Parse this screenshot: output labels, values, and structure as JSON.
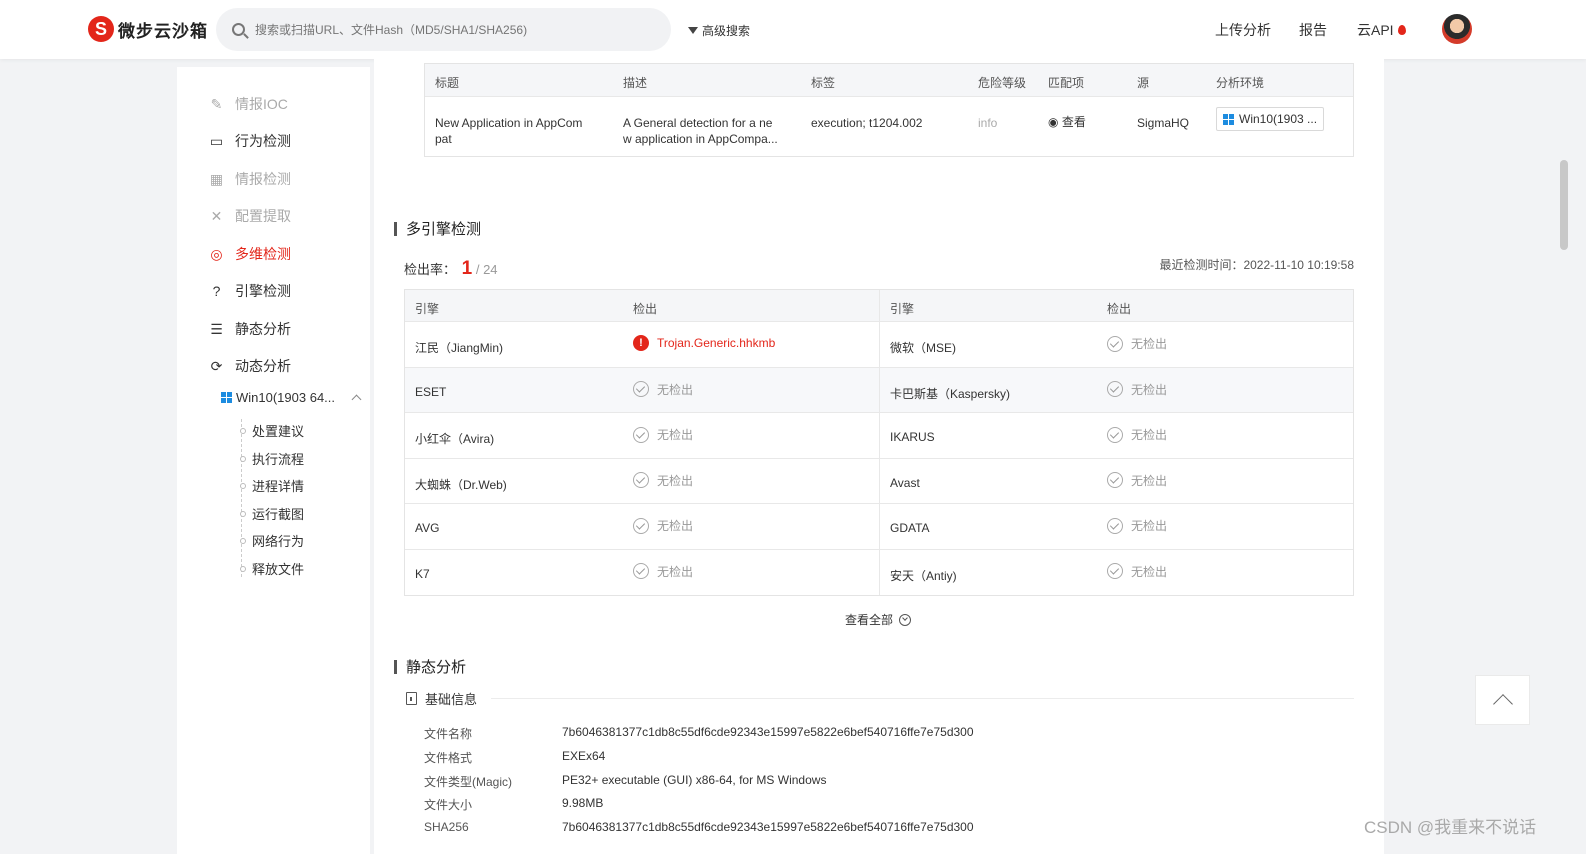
{
  "header": {
    "logo_letter": "S",
    "logo_text": "微步云沙箱",
    "search_placeholder": "搜索或扫描URL、文件Hash（MD5/SHA1/SHA256)",
    "advanced_search": "高级搜索",
    "nav": [
      "上传分析",
      "报告",
      "云API"
    ]
  },
  "sidebar": {
    "items": [
      {
        "label": "情报IOC",
        "icon": "✎",
        "state": "disabled"
      },
      {
        "label": "行为检测",
        "icon": "▭",
        "state": "normal"
      },
      {
        "label": "情报检测",
        "icon": "▦",
        "state": "disabled"
      },
      {
        "label": "配置提取",
        "icon": "✕",
        "state": "disabled"
      },
      {
        "label": "多维检测",
        "icon": "◎",
        "state": "active"
      },
      {
        "label": "引擎检测",
        "icon": "?",
        "state": "normal"
      },
      {
        "label": "静态分析",
        "icon": "☰",
        "state": "normal"
      },
      {
        "label": "动态分析",
        "icon": "⟳",
        "state": "normal"
      }
    ],
    "env_label": "Win10(1903 64...",
    "sub_items": [
      "处置建议",
      "执行流程",
      "进程详情",
      "运行截图",
      "网络行为",
      "释放文件"
    ]
  },
  "sigma": {
    "headers": [
      "标题",
      "描述",
      "标签",
      "危险等级",
      "匹配项",
      "源",
      "分析环境"
    ],
    "row": {
      "title": "New Application in AppCompat",
      "title_line1": "New Application in AppCom",
      "title_line2": "pat",
      "desc_line1": "A General detection for a ne",
      "desc_line2": "w application in AppCompa...",
      "tags": "execution; t1204.002",
      "level": "info",
      "match": "查看",
      "source": "SigmaHQ",
      "env": "Win10(1903 ..."
    }
  },
  "multi_engine": {
    "title": "多引擎检测",
    "rate_label": "检出率：",
    "detected": "1",
    "total": "/ 24",
    "last_time": "最近检测时间：2022-11-10 10:19:58",
    "headers": [
      "引擎",
      "检出",
      "引擎",
      "检出"
    ],
    "rows": [
      {
        "left": "江民（JiangMin)",
        "left_result": "Trojan.Generic.hhkmb",
        "left_detected": true,
        "right": "微软（MSE)",
        "right_result": "无检出"
      },
      {
        "left": "ESET",
        "left_result": "无检出",
        "left_detected": false,
        "right": "卡巴斯基（Kaspersky)",
        "right_result": "无检出"
      },
      {
        "left": "小红伞（Avira)",
        "left_result": "无检出",
        "left_detected": false,
        "right": "IKARUS",
        "right_result": "无检出"
      },
      {
        "left": "大蜘蛛（Dr.Web)",
        "left_result": "无检出",
        "left_detected": false,
        "right": "Avast",
        "right_result": "无检出"
      },
      {
        "left": "AVG",
        "left_result": "无检出",
        "left_detected": false,
        "right": "GDATA",
        "right_result": "无检出"
      },
      {
        "left": "K7",
        "left_result": "无检出",
        "left_detected": false,
        "right": "安天（Antiy)",
        "right_result": "无检出"
      }
    ],
    "view_all": "查看全部"
  },
  "static": {
    "title": "静态分析",
    "basic_title": "基础信息",
    "fields": [
      {
        "key": "文件名称",
        "value": "7b6046381377c1db8c55df6cde92343e15997e5822e6bef540716ffe7e75d300"
      },
      {
        "key": "文件格式",
        "value": "EXEx64"
      },
      {
        "key": "文件类型(Magic)",
        "value": "PE32+ executable (GUI) x86-64, for MS Windows"
      },
      {
        "key": "文件大小",
        "value": "9.98MB"
      },
      {
        "key": "SHA256",
        "value": "7b6046381377c1db8c55df6cde92343e15997e5822e6bef540716ffe7e75d300"
      }
    ]
  },
  "watermark": "CSDN @我重来不说话",
  "colors": {
    "accent": "#e3261a",
    "windows_blue": "#1d8ce0"
  }
}
